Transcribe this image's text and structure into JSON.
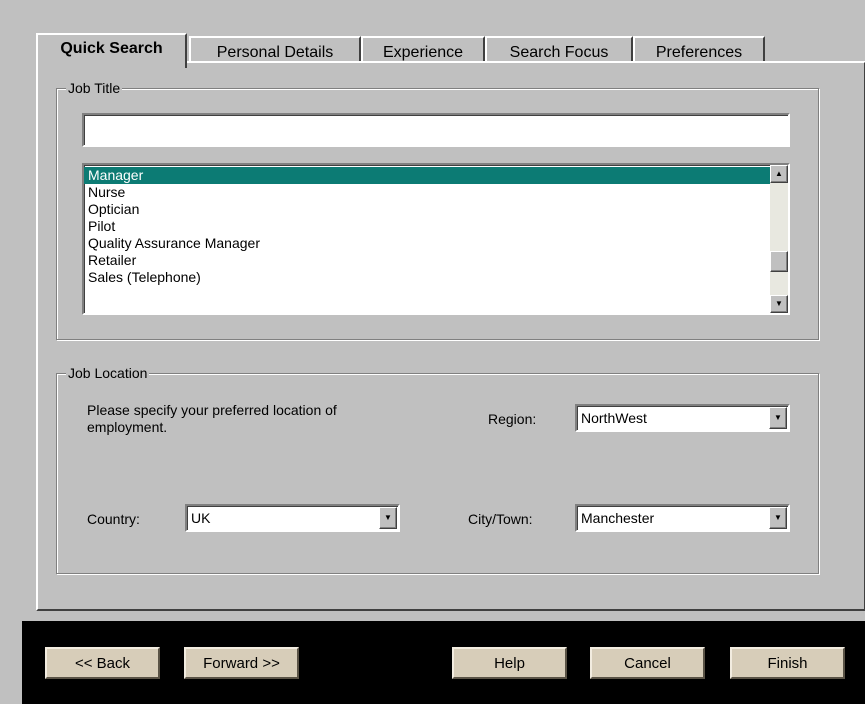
{
  "tabs": [
    {
      "label": "Quick Search",
      "active": true
    },
    {
      "label": "Personal Details",
      "active": false
    },
    {
      "label": "Experience",
      "active": false
    },
    {
      "label": "Search Focus",
      "active": false
    },
    {
      "label": "Preferences",
      "active": false
    }
  ],
  "job_title": {
    "legend": "Job Title",
    "input_value": "",
    "list_items": [
      "Manager",
      "Nurse",
      "Optician",
      "Pilot",
      "Quality Assurance Manager",
      "Retailer",
      "Sales (Telephone)"
    ],
    "selected": "Manager",
    "scroll_position": 0.75
  },
  "job_location": {
    "legend": "Job Location",
    "description": "Please specify your preferred location of employment.",
    "region_label": "Region:",
    "region_value": "NorthWest",
    "country_label": "Country:",
    "country_value": "UK",
    "city_label": "City/Town:",
    "city_value": "Manchester"
  },
  "buttons": {
    "back": "<< Back",
    "forward": "Forward >>",
    "help": "Help",
    "cancel": "Cancel",
    "finish": "Finish"
  },
  "icons": {
    "scroll_up": "scroll-up-arrow-icon",
    "scroll_down": "scroll-down-arrow-icon",
    "dropdown": "dropdown-arrow-icon"
  },
  "colors": {
    "selection": "#0c7b74",
    "window_bg": "#c0c0c0",
    "button_face": "#d7cdb9",
    "button_bar": "#000000"
  }
}
